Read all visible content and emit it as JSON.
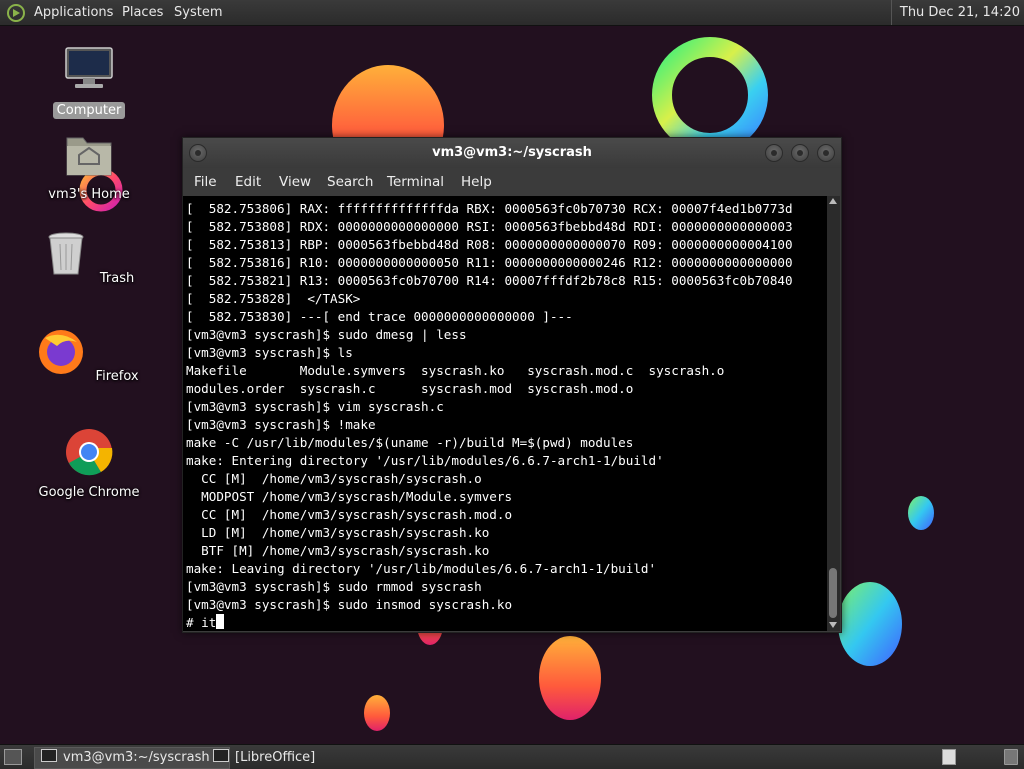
{
  "top_panel": {
    "applications": "Applications",
    "places": "Places",
    "system": "System",
    "clock": "Thu Dec 21, 14:20"
  },
  "desktop": {
    "icons": [
      {
        "label": "Computer",
        "icon": "computer-icon"
      },
      {
        "label": "vm3's Home",
        "icon": "home-folder-icon"
      },
      {
        "label": "Trash",
        "icon": "trash-icon"
      },
      {
        "label": "Firefox",
        "icon": "firefox-icon"
      },
      {
        "label": "Google Chrome",
        "icon": "chrome-icon"
      }
    ]
  },
  "terminal": {
    "title": "vm3@vm3:~/syscrash",
    "menu": [
      "File",
      "Edit",
      "View",
      "Search",
      "Terminal",
      "Help"
    ],
    "lines": [
      "[  582.753806] RAX: ffffffffffffffda RBX: 0000563fc0b70730 RCX: 00007f4ed1b0773d",
      "[  582.753808] RDX: 0000000000000000 RSI: 0000563fbebbd48d RDI: 0000000000000003",
      "[  582.753813] RBP: 0000563fbebbd48d R08: 0000000000000070 R09: 0000000000004100",
      "[  582.753816] R10: 0000000000000050 R11: 0000000000000246 R12: 0000000000000000",
      "[  582.753821] R13: 0000563fc0b70700 R14: 00007fffdf2b78c8 R15: 0000563fc0b70840",
      "[  582.753828]  </TASK>",
      "[  582.753830] ---[ end trace 0000000000000000 ]---",
      "[vm3@vm3 syscrash]$ sudo dmesg | less",
      "[vm3@vm3 syscrash]$ ls",
      "Makefile       Module.symvers  syscrash.ko   syscrash.mod.c  syscrash.o",
      "modules.order  syscrash.c      syscrash.mod  syscrash.mod.o",
      "[vm3@vm3 syscrash]$ vim syscrash.c",
      "[vm3@vm3 syscrash]$ !make",
      "make -C /usr/lib/modules/$(uname -r)/build M=$(pwd) modules",
      "make: Entering directory '/usr/lib/modules/6.6.7-arch1-1/build'",
      "  CC [M]  /home/vm3/syscrash/syscrash.o",
      "  MODPOST /home/vm3/syscrash/Module.symvers",
      "  CC [M]  /home/vm3/syscrash/syscrash.mod.o",
      "  LD [M]  /home/vm3/syscrash/syscrash.ko",
      "  BTF [M] /home/vm3/syscrash/syscrash.ko",
      "make: Leaving directory '/usr/lib/modules/6.6.7-arch1-1/build'",
      "[vm3@vm3 syscrash]$ sudo rmmod syscrash",
      "[vm3@vm3 syscrash]$ sudo insmod syscrash.ko"
    ],
    "prompt_input": "# it"
  },
  "bottom_panel": {
    "tasks": [
      {
        "label": "vm3@vm3:~/syscrash",
        "active": true
      },
      {
        "label": "[LibreOffice]",
        "active": false
      }
    ]
  },
  "colors": {
    "background": "#22101f",
    "panel": "#2f2f2f",
    "terminal_bg": "#000000",
    "terminal_fg": "#ffffff"
  }
}
